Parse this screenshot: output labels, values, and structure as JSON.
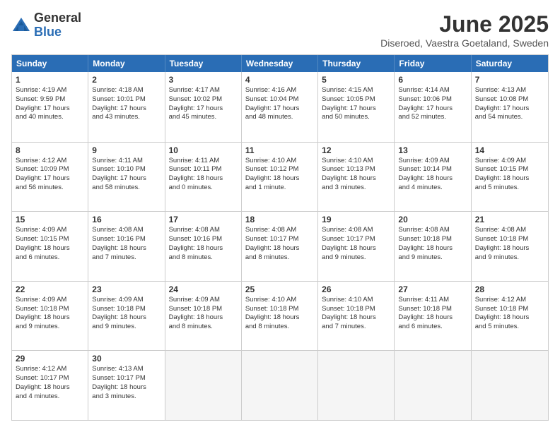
{
  "logo": {
    "general": "General",
    "blue": "Blue"
  },
  "title": "June 2025",
  "location": "Diseroed, Vaestra Goetaland, Sweden",
  "weekdays": [
    "Sunday",
    "Monday",
    "Tuesday",
    "Wednesday",
    "Thursday",
    "Friday",
    "Saturday"
  ],
  "weeks": [
    [
      {
        "day": "1",
        "text": "Sunrise: 4:19 AM\nSunset: 9:59 PM\nDaylight: 17 hours\nand 40 minutes."
      },
      {
        "day": "2",
        "text": "Sunrise: 4:18 AM\nSunset: 10:01 PM\nDaylight: 17 hours\nand 43 minutes."
      },
      {
        "day": "3",
        "text": "Sunrise: 4:17 AM\nSunset: 10:02 PM\nDaylight: 17 hours\nand 45 minutes."
      },
      {
        "day": "4",
        "text": "Sunrise: 4:16 AM\nSunset: 10:04 PM\nDaylight: 17 hours\nand 48 minutes."
      },
      {
        "day": "5",
        "text": "Sunrise: 4:15 AM\nSunset: 10:05 PM\nDaylight: 17 hours\nand 50 minutes."
      },
      {
        "day": "6",
        "text": "Sunrise: 4:14 AM\nSunset: 10:06 PM\nDaylight: 17 hours\nand 52 minutes."
      },
      {
        "day": "7",
        "text": "Sunrise: 4:13 AM\nSunset: 10:08 PM\nDaylight: 17 hours\nand 54 minutes."
      }
    ],
    [
      {
        "day": "8",
        "text": "Sunrise: 4:12 AM\nSunset: 10:09 PM\nDaylight: 17 hours\nand 56 minutes."
      },
      {
        "day": "9",
        "text": "Sunrise: 4:11 AM\nSunset: 10:10 PM\nDaylight: 17 hours\nand 58 minutes."
      },
      {
        "day": "10",
        "text": "Sunrise: 4:11 AM\nSunset: 10:11 PM\nDaylight: 18 hours\nand 0 minutes."
      },
      {
        "day": "11",
        "text": "Sunrise: 4:10 AM\nSunset: 10:12 PM\nDaylight: 18 hours\nand 1 minute."
      },
      {
        "day": "12",
        "text": "Sunrise: 4:10 AM\nSunset: 10:13 PM\nDaylight: 18 hours\nand 3 minutes."
      },
      {
        "day": "13",
        "text": "Sunrise: 4:09 AM\nSunset: 10:14 PM\nDaylight: 18 hours\nand 4 minutes."
      },
      {
        "day": "14",
        "text": "Sunrise: 4:09 AM\nSunset: 10:15 PM\nDaylight: 18 hours\nand 5 minutes."
      }
    ],
    [
      {
        "day": "15",
        "text": "Sunrise: 4:09 AM\nSunset: 10:15 PM\nDaylight: 18 hours\nand 6 minutes."
      },
      {
        "day": "16",
        "text": "Sunrise: 4:08 AM\nSunset: 10:16 PM\nDaylight: 18 hours\nand 7 minutes."
      },
      {
        "day": "17",
        "text": "Sunrise: 4:08 AM\nSunset: 10:16 PM\nDaylight: 18 hours\nand 8 minutes."
      },
      {
        "day": "18",
        "text": "Sunrise: 4:08 AM\nSunset: 10:17 PM\nDaylight: 18 hours\nand 8 minutes."
      },
      {
        "day": "19",
        "text": "Sunrise: 4:08 AM\nSunset: 10:17 PM\nDaylight: 18 hours\nand 9 minutes."
      },
      {
        "day": "20",
        "text": "Sunrise: 4:08 AM\nSunset: 10:18 PM\nDaylight: 18 hours\nand 9 minutes."
      },
      {
        "day": "21",
        "text": "Sunrise: 4:08 AM\nSunset: 10:18 PM\nDaylight: 18 hours\nand 9 minutes."
      }
    ],
    [
      {
        "day": "22",
        "text": "Sunrise: 4:09 AM\nSunset: 10:18 PM\nDaylight: 18 hours\nand 9 minutes."
      },
      {
        "day": "23",
        "text": "Sunrise: 4:09 AM\nSunset: 10:18 PM\nDaylight: 18 hours\nand 9 minutes."
      },
      {
        "day": "24",
        "text": "Sunrise: 4:09 AM\nSunset: 10:18 PM\nDaylight: 18 hours\nand 8 minutes."
      },
      {
        "day": "25",
        "text": "Sunrise: 4:10 AM\nSunset: 10:18 PM\nDaylight: 18 hours\nand 8 minutes."
      },
      {
        "day": "26",
        "text": "Sunrise: 4:10 AM\nSunset: 10:18 PM\nDaylight: 18 hours\nand 7 minutes."
      },
      {
        "day": "27",
        "text": "Sunrise: 4:11 AM\nSunset: 10:18 PM\nDaylight: 18 hours\nand 6 minutes."
      },
      {
        "day": "28",
        "text": "Sunrise: 4:12 AM\nSunset: 10:18 PM\nDaylight: 18 hours\nand 5 minutes."
      }
    ],
    [
      {
        "day": "29",
        "text": "Sunrise: 4:12 AM\nSunset: 10:17 PM\nDaylight: 18 hours\nand 4 minutes."
      },
      {
        "day": "30",
        "text": "Sunrise: 4:13 AM\nSunset: 10:17 PM\nDaylight: 18 hours\nand 3 minutes."
      },
      {
        "day": "",
        "text": ""
      },
      {
        "day": "",
        "text": ""
      },
      {
        "day": "",
        "text": ""
      },
      {
        "day": "",
        "text": ""
      },
      {
        "day": "",
        "text": ""
      }
    ]
  ]
}
